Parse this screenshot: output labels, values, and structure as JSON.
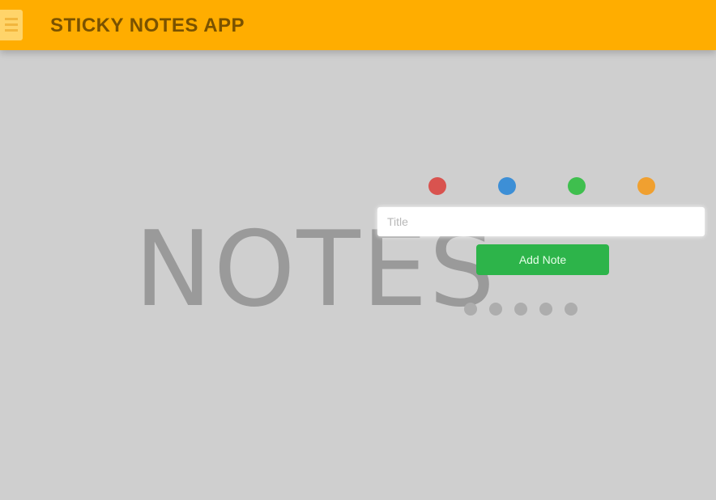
{
  "header": {
    "title": "STICKY NOTES APP",
    "icon": "note-icon",
    "color": "#ffad00"
  },
  "background_word": "NOTES",
  "color_picker": {
    "options": [
      {
        "name": "red",
        "color": "#d9534f"
      },
      {
        "name": "blue",
        "color": "#3d8fd6"
      },
      {
        "name": "green",
        "color": "#3fbf4e"
      },
      {
        "name": "orange",
        "color": "#f0a030"
      }
    ]
  },
  "note_input": {
    "value": "",
    "placeholder": "Title"
  },
  "add_button": {
    "label": "Add Note",
    "color": "#2db44a"
  },
  "pagination": {
    "count": 5
  }
}
